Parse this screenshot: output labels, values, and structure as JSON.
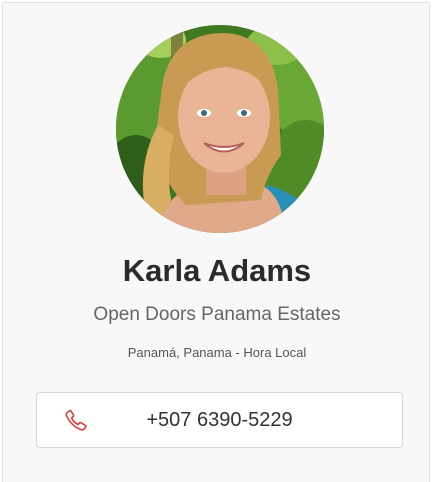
{
  "agent": {
    "name": "Karla Adams",
    "company": "Open Doors Panama Estates",
    "location": "Panamá, Panama - Hora Local",
    "avatar_icon": "agent-portrait"
  },
  "contact": {
    "phone": "+507 6390-5229",
    "phone_icon": "phone-icon"
  },
  "colors": {
    "accent": "#d9403a",
    "name_text": "#2b2b2b",
    "secondary_text": "#666666",
    "card_background": "#f8f8f8"
  }
}
